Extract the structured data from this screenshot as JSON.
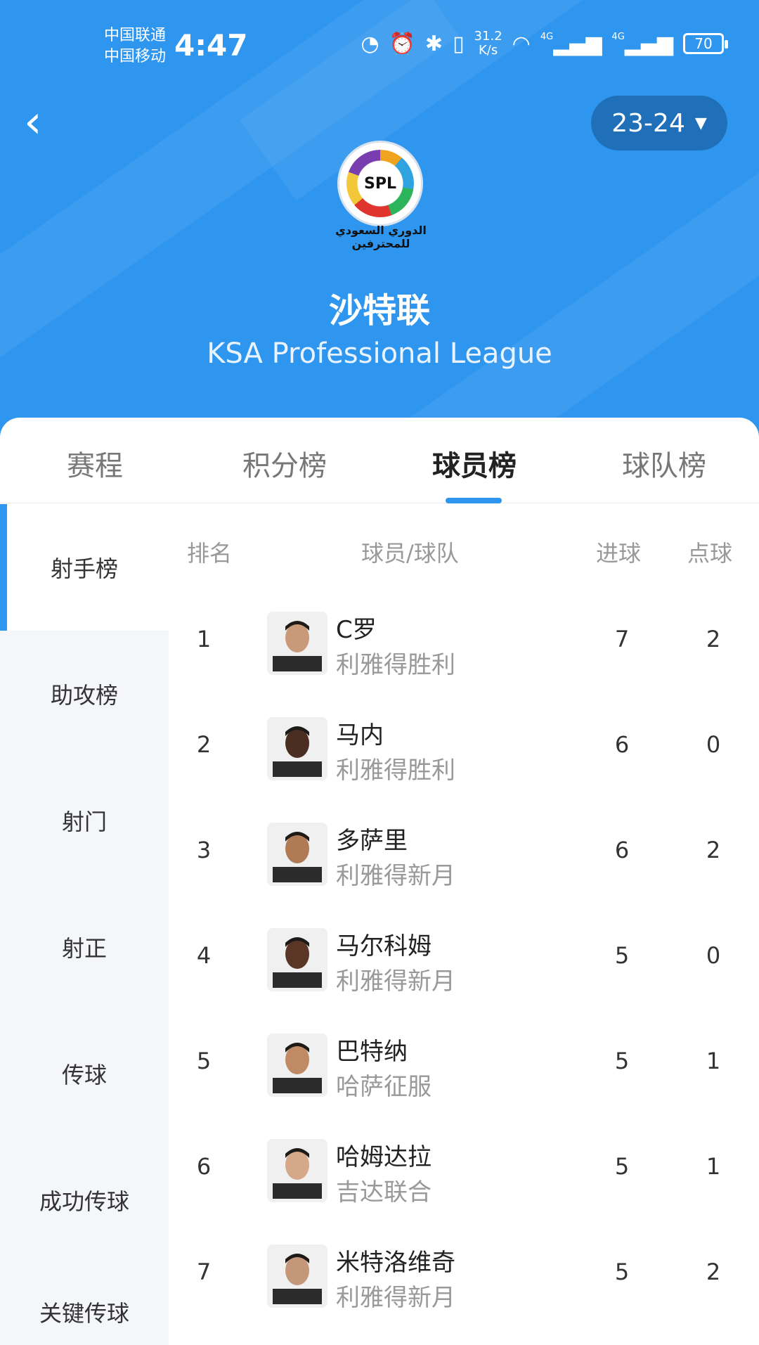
{
  "status_bar": {
    "carrier_1": "中国联通",
    "carrier_2": "中国移动",
    "time": "4:47",
    "net_speed_value": "31.2",
    "net_speed_unit": "K/s",
    "signal_1": "4G",
    "signal_2": "4G",
    "battery": "70"
  },
  "header": {
    "season": "23-24",
    "logo_text": "SPL",
    "logo_caption": "الدوري السعودي للمحترفين",
    "league_name_cn": "沙特联",
    "league_name_en": "KSA Professional League"
  },
  "tabs": [
    "赛程",
    "积分榜",
    "球员榜",
    "球队榜"
  ],
  "active_tab": "球员榜",
  "side_menu": [
    "射手榜",
    "助攻榜",
    "射门",
    "射正",
    "传球",
    "成功传球",
    "关键传球"
  ],
  "columns": {
    "rank": "排名",
    "player_team": "球员/球队",
    "goals": "进球",
    "penalties": "点球"
  },
  "rows": [
    {
      "rank": "1",
      "name": "C罗",
      "team": "利雅得胜利",
      "goals": "7",
      "penalties": "2"
    },
    {
      "rank": "2",
      "name": "马内",
      "team": "利雅得胜利",
      "goals": "6",
      "penalties": "0"
    },
    {
      "rank": "3",
      "name": "多萨里",
      "team": "利雅得新月",
      "goals": "6",
      "penalties": "2"
    },
    {
      "rank": "4",
      "name": "马尔科姆",
      "team": "利雅得新月",
      "goals": "5",
      "penalties": "0"
    },
    {
      "rank": "5",
      "name": "巴特纳",
      "team": "哈萨征服",
      "goals": "5",
      "penalties": "1"
    },
    {
      "rank": "6",
      "name": "哈姆达拉",
      "team": "吉达联合",
      "goals": "5",
      "penalties": "1"
    },
    {
      "rank": "7",
      "name": "米特洛维奇",
      "team": "利雅得新月",
      "goals": "5",
      "penalties": "2"
    }
  ],
  "colors": {
    "header_bg": "#2f96f0",
    "accent": "#2f96f0",
    "season_pill": "#1f70b8"
  }
}
